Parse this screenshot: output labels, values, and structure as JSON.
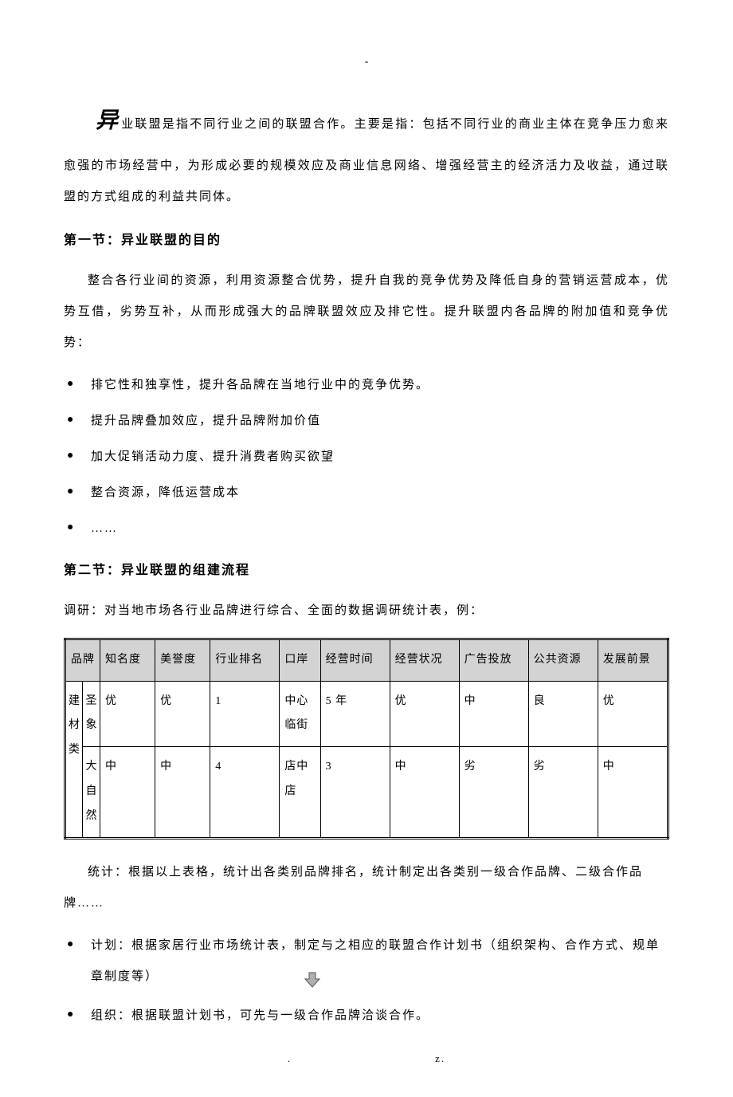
{
  "top_dash": "-",
  "intro": {
    "dropcap": "异",
    "rest": "业联盟是指不同行业之间的联盟合作。主要是指：包括不同行业的商业主体在竞争压力愈来愈强的市场经营中，为形成必要的规模效应及商业信息网络、增强经营主的经济活力及收益，通过联盟的方式组成的利益共同体。"
  },
  "section1": {
    "heading": "第一节：异业联盟的目的",
    "para": "整合各行业间的资源，利用资源整合优势，提升自我的竞争优势及降低自身的营销运营成本，优势互借，劣势互补，从而形成强大的品牌联盟效应及排它性。提升联盟内各品牌的附加值和竞争优势：",
    "bullets": [
      "排它性和独享性，提升各品牌在当地行业中的竞争优势。",
      "提升品牌叠加效应，提升品牌附加价值",
      "加大促销活动力度、提升消费者购买欲望",
      "整合资源，降低运营成本",
      "……"
    ]
  },
  "section2": {
    "heading": "第二节：异业联盟的组建流程",
    "intro": "调研：对当地市场各行业品牌进行综合、全面的数据调研统计表，例：",
    "table": {
      "headers": [
        "品牌",
        "知名度",
        "美誉度",
        "行业排名",
        "口岸",
        "经营时间",
        "经营状况",
        "广告投放",
        "公共资源",
        "发展前景"
      ],
      "row_group": "建材类",
      "rows": [
        {
          "brand": "圣象",
          "cells": [
            "优",
            "优",
            "1",
            "中心临街",
            "5 年",
            "优",
            "中",
            "良",
            "优"
          ]
        },
        {
          "brand": "大自然",
          "cells": [
            "中",
            "中",
            "4",
            "店中店",
            "3",
            "中",
            "劣",
            "劣",
            "中"
          ]
        }
      ]
    },
    "after_table": "统计：根据以上表格，统计出各类别品牌排名，统计制定出各类别一级合作品牌、二级合作品牌……",
    "plan_bullets": [
      "计划：根据家居行业市场统计表，制定与之相应的联盟合作计划书（组织架构、合作方式、规单章制度等）",
      "组织：根据联盟计划书，可先与一级合作品牌洽谈合作。"
    ]
  },
  "footer_left": ".",
  "footer_right": "z."
}
